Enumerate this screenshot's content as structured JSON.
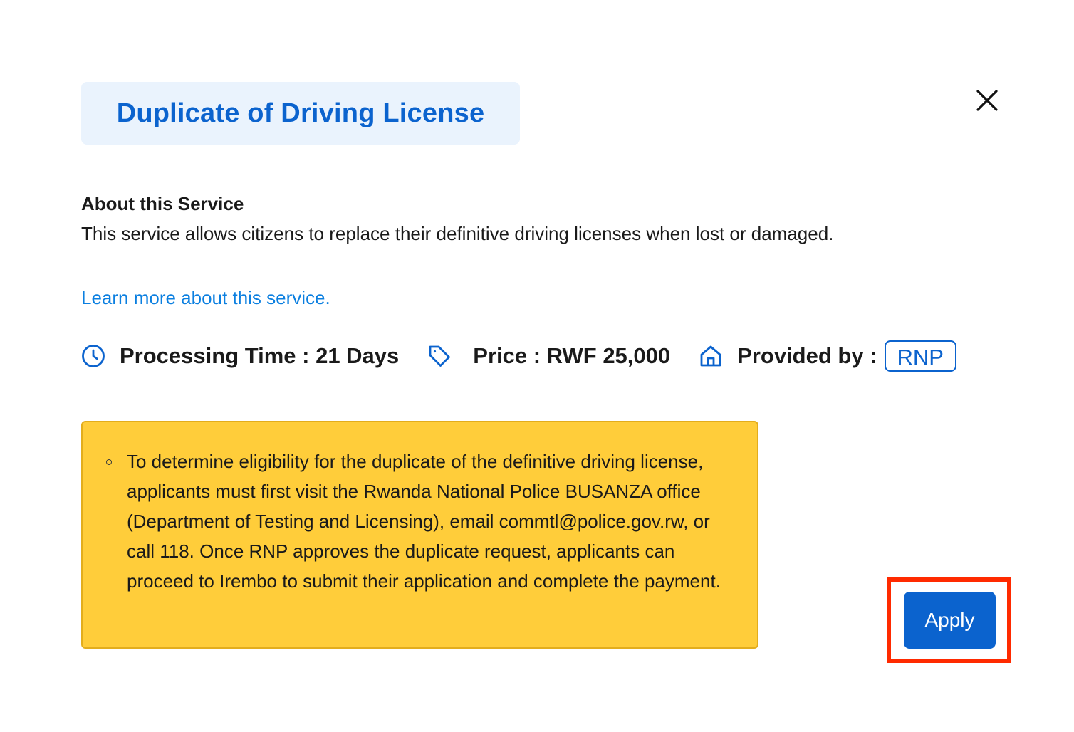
{
  "modal": {
    "title": "Duplicate of Driving License",
    "close_icon": "close-icon"
  },
  "about": {
    "heading": "About this Service",
    "description": "This service allows citizens to replace their definitive driving licenses when lost or damaged.",
    "learn_more": "Learn more about this service."
  },
  "meta": {
    "processing_time": {
      "icon": "clock-icon",
      "label": "Processing Time : 21 Days"
    },
    "price": {
      "icon": "price-tag-icon",
      "label": "Price : RWF 25,000"
    },
    "provider": {
      "icon": "home-icon",
      "label": "Provided by :",
      "value": "RNP"
    }
  },
  "notice": {
    "items": [
      "To determine eligibility for the duplicate of the definitive driving license, applicants must first visit the Rwanda National Police BUSANZA office (Department of Testing and Licensing), email commtl@police.gov.rw, or call 118. Once RNP approves the duplicate request, applicants can proceed to Irembo to submit their application and complete the payment."
    ]
  },
  "actions": {
    "apply_label": "Apply"
  },
  "colors": {
    "brand_blue": "#0b63ce",
    "link_blue": "#0b7fe0",
    "title_chip_bg": "#eaf3fd",
    "notice_bg": "#ffcd3a",
    "highlight_red": "#ff2a00"
  }
}
